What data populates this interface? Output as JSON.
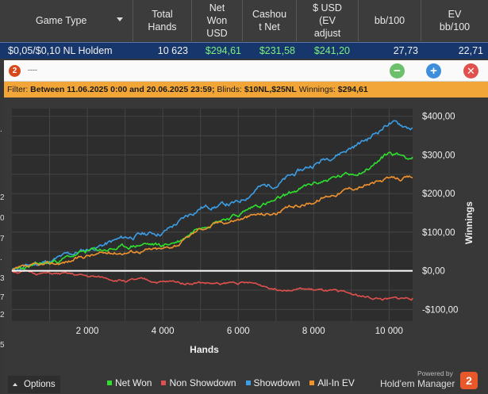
{
  "table": {
    "headers": [
      {
        "label": "Game Type"
      },
      {
        "label": "Total\nHands"
      },
      {
        "label": "Net\nWon\nUSD"
      },
      {
        "label": "Cashou\nt Net"
      },
      {
        "label": "$ USD\n(EV\nadjust"
      },
      {
        "label": "bb/100"
      },
      {
        "label": "EV\nbb/100"
      }
    ],
    "row": {
      "game_type": "$0,05/$0,10 NL Holdem",
      "total_hands": "10 623",
      "net_won": "$294,61",
      "cashout_net": "$231,58",
      "ev_adjusted": "$241,20",
      "bb100": "27,73",
      "ev_bb100": "22,71"
    }
  },
  "window": {
    "logo_label": "2",
    "title": "----",
    "minimize_label": "−",
    "add_label": "+",
    "close_label": "✕"
  },
  "filter": {
    "prefix": "Filter:",
    "range_label": "Between 11.06.2025 0:00 and 20.06.2025 23:59;",
    "blinds_key": "Blinds:",
    "blinds_value": "$10NL,$25NL",
    "winnings_key": "Winnings:",
    "winnings_value": "$294,61"
  },
  "left_edge_digits": [
    ".",
    "2.",
    "0.",
    "7.",
    ".",
    "3.",
    "7.",
    "2.",
    "5."
  ],
  "chart_data": {
    "type": "line",
    "xlabel": "Hands",
    "ylabel": "Winnings",
    "xlim": [
      0,
      10623
    ],
    "ylim": [
      -130,
      420
    ],
    "x_ticks": [
      2000,
      4000,
      6000,
      8000,
      10000
    ],
    "x_tick_labels": [
      "2 000",
      "4 000",
      "6 000",
      "8 000",
      "10 000"
    ],
    "y_ticks": [
      -100,
      0,
      100,
      200,
      300,
      400
    ],
    "y_tick_labels": [
      "-$100,00",
      "$0,00",
      "$100,00",
      "$200,00",
      "$300,00",
      "$400,00"
    ],
    "grid": true,
    "legend_position": "bottom",
    "x": [
      0,
      500,
      1000,
      1500,
      2000,
      2500,
      3000,
      3500,
      4000,
      4500,
      5000,
      5500,
      6000,
      6500,
      7000,
      7500,
      8000,
      8500,
      9000,
      9500,
      10000,
      10623
    ],
    "series": [
      {
        "name": "Showdown",
        "color": "#3c9ee6",
        "values": [
          0,
          15,
          25,
          40,
          55,
          70,
          85,
          95,
          100,
          130,
          165,
          170,
          175,
          215,
          225,
          250,
          275,
          300,
          320,
          345,
          385,
          370
        ]
      },
      {
        "name": "Net Won",
        "color": "#2ee02e",
        "values": [
          0,
          10,
          20,
          35,
          50,
          55,
          60,
          70,
          65,
          80,
          120,
          135,
          145,
          170,
          180,
          205,
          225,
          240,
          250,
          270,
          305,
          294.61
        ]
      },
      {
        "name": "All-In EV",
        "color": "#f0922e",
        "values": [
          0,
          8,
          15,
          25,
          40,
          45,
          50,
          55,
          55,
          75,
          110,
          125,
          135,
          145,
          150,
          165,
          180,
          200,
          215,
          225,
          235,
          241.2
        ]
      },
      {
        "name": "Non Showdown",
        "color": "#e0504d",
        "values": [
          0,
          -5,
          -8,
          -10,
          -15,
          -20,
          -25,
          -25,
          -30,
          -30,
          -30,
          -35,
          -30,
          -35,
          -45,
          -45,
          -50,
          -55,
          -60,
          -70,
          -75,
          -70
        ]
      }
    ],
    "zero_line_color": "#ffffff"
  },
  "footer": {
    "options_label": "Options",
    "powered_by": "Powered by",
    "brand": "Hold'em Manager",
    "brand_badge": "2"
  }
}
